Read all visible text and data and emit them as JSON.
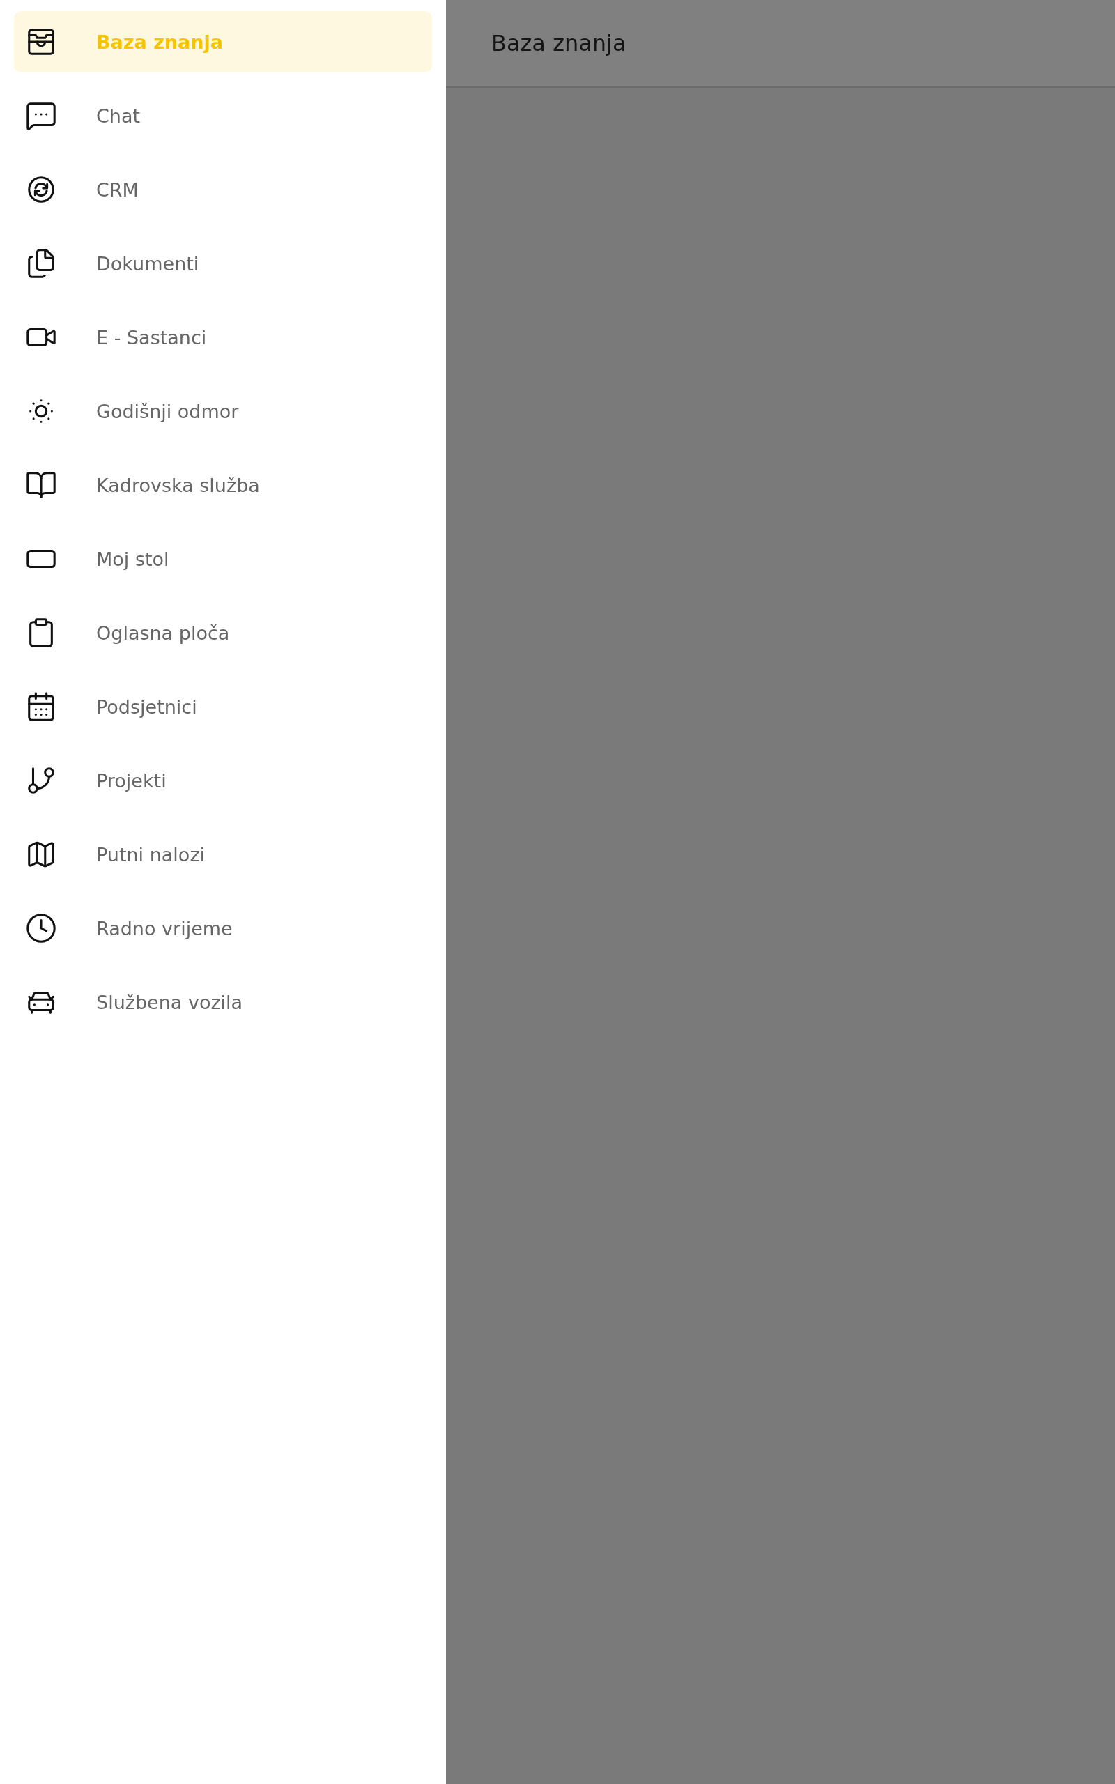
{
  "sidebar": {
    "items": [
      {
        "label": "Baza znanja",
        "selected": true
      },
      {
        "label": "Chat",
        "selected": false
      },
      {
        "label": "CRM",
        "selected": false
      },
      {
        "label": "Dokumenti",
        "selected": false
      },
      {
        "label": "E - Sastanci",
        "selected": false
      },
      {
        "label": "Godišnji odmor",
        "selected": false
      },
      {
        "label": "Kadrovska služba",
        "selected": false
      },
      {
        "label": "Moj stol",
        "selected": false
      },
      {
        "label": "Oglasna ploča",
        "selected": false
      },
      {
        "label": "Podsjetnici",
        "selected": false
      },
      {
        "label": "Projekti",
        "selected": false
      },
      {
        "label": "Putni nalozi",
        "selected": false
      },
      {
        "label": "Radno vrijeme",
        "selected": false
      },
      {
        "label": "Službena vozila",
        "selected": false
      }
    ]
  },
  "header": {
    "title": "Baza znanja"
  }
}
